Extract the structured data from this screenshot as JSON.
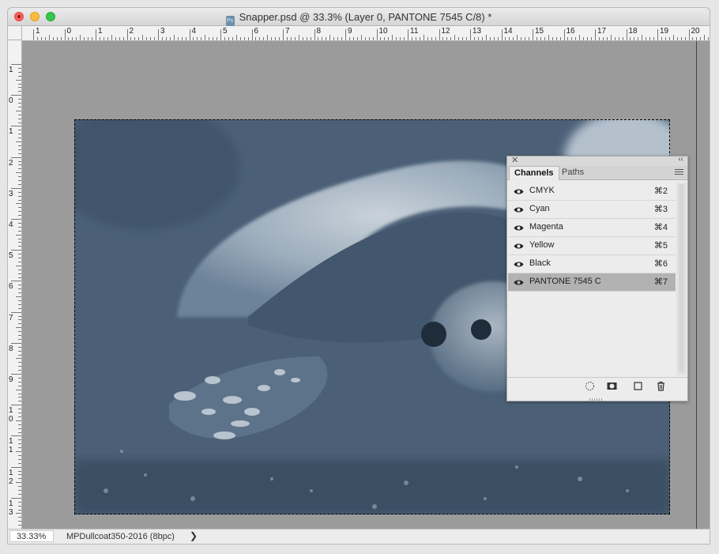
{
  "window": {
    "title": "Snapper.psd @ 33.3% (Layer 0, PANTONE 7545 C/8) *",
    "app_icon": "Ps"
  },
  "ruler_top_labels": [
    "1",
    "0",
    "1",
    "2",
    "3",
    "4",
    "5",
    "6",
    "7",
    "8",
    "9",
    "10",
    "11",
    "12",
    "13",
    "14",
    "15",
    "16",
    "17",
    "18",
    "19",
    "20"
  ],
  "ruler_left_labels": [
    "1",
    "0",
    "1",
    "2",
    "3",
    "4",
    "5",
    "6",
    "7",
    "8",
    "9",
    "1\n0",
    "1\n1",
    "1\n2",
    "1\n3"
  ],
  "document": {
    "image_description_icon": "tortoise-photo"
  },
  "channels_panel": {
    "tabs": [
      {
        "label": "Channels"
      },
      {
        "label": "Paths"
      }
    ],
    "channels": [
      {
        "name": "CMYK",
        "shortcut": "⌘2",
        "selected": false
      },
      {
        "name": "Cyan",
        "shortcut": "⌘3",
        "selected": false
      },
      {
        "name": "Magenta",
        "shortcut": "⌘4",
        "selected": false
      },
      {
        "name": "Yellow",
        "shortcut": "⌘5",
        "selected": false
      },
      {
        "name": "Black",
        "shortcut": "⌘6",
        "selected": false
      },
      {
        "name": "PANTONE 7545 C",
        "shortcut": "⌘7",
        "selected": true
      }
    ]
  },
  "statusbar": {
    "zoom": "33.33%",
    "doc_info": "MPDullcoat350-2016 (8bpc)",
    "chevron": "❯"
  }
}
